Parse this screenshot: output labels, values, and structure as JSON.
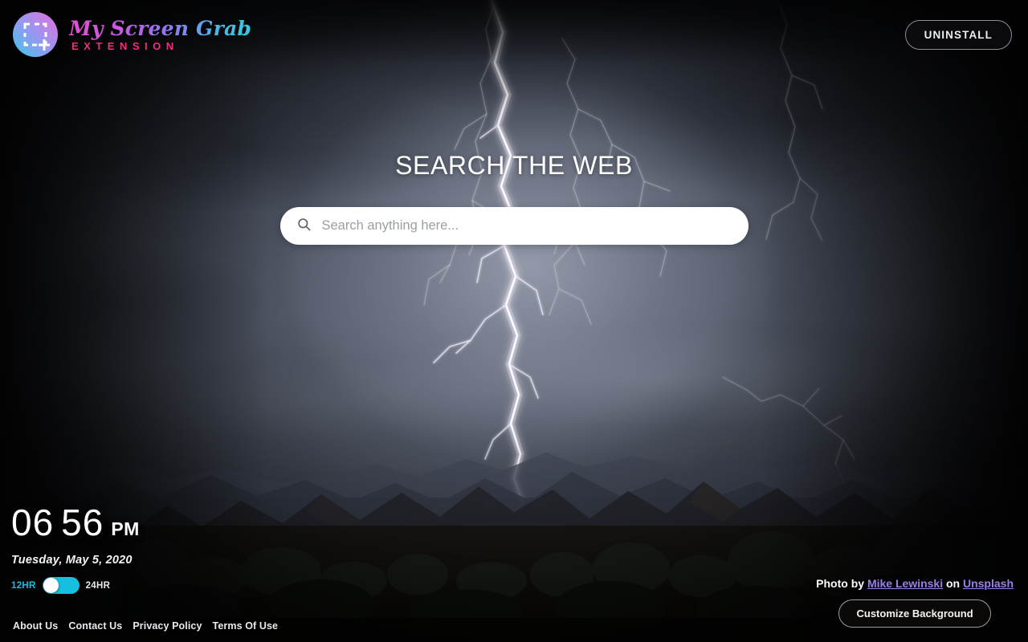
{
  "header": {
    "brand": {
      "title": "My Screen Grab",
      "subtitle": "EXTENSION",
      "logo_icon": "crop-frame-plus-icon"
    },
    "uninstall_label": "UNINSTALL"
  },
  "search": {
    "heading": "SEARCH THE WEB",
    "placeholder": "Search anything here...",
    "value": "",
    "icon": "search-icon"
  },
  "clock": {
    "hours": "06",
    "minutes": "56",
    "meridiem": "PM",
    "date": "Tuesday, May 5, 2020",
    "format_left_label": "12HR",
    "format_right_label": "24HR",
    "format_active": "12HR",
    "accent_color": "#16bfe0"
  },
  "footer": {
    "links": [
      {
        "label": "About Us"
      },
      {
        "label": "Contact Us"
      },
      {
        "label": "Privacy Policy"
      },
      {
        "label": "Terms Of Use"
      }
    ]
  },
  "attribution": {
    "prefix": "Photo by",
    "photographer": "Mike Lewinski",
    "middle": "on",
    "source": "Unsplash",
    "link_color": "#9b7fe8"
  },
  "customize": {
    "label": "Customize Background"
  },
  "wallpaper": {
    "subject": "lightning storm over mountains",
    "sky_color": "#5f6575",
    "dark_edge_color": "#121315"
  }
}
